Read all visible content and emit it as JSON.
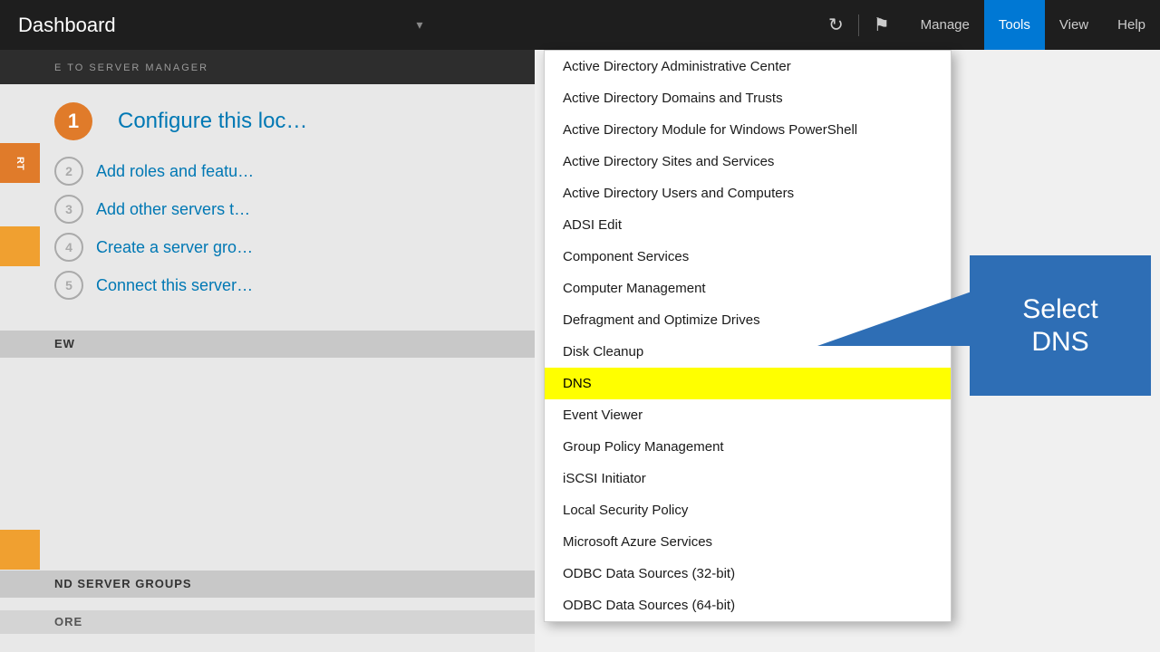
{
  "titleBar": {
    "title": "Dashboard",
    "dropdownArrow": "▾",
    "refreshIcon": "↻",
    "flagIcon": "⚑"
  },
  "menuBar": {
    "items": [
      {
        "label": "Manage",
        "active": false
      },
      {
        "label": "Tools",
        "active": true
      },
      {
        "label": "View",
        "active": false
      },
      {
        "label": "Help",
        "active": false
      }
    ]
  },
  "leftPanel": {
    "welcomeSubtitle": "WELCOME TO SERVER MANAGER",
    "quickStartHeader": "Configure this loc…",
    "step1": {
      "number": "1",
      "label": "Configure this loc…"
    },
    "step2": {
      "number": "2",
      "label": "Add roles and featu…"
    },
    "step3": {
      "number": "3",
      "label": "Add other servers t…"
    },
    "step4": {
      "number": "4",
      "label": "Create a server gro…"
    },
    "step5": {
      "number": "5",
      "label": "Connect this server…"
    },
    "sectionStart": "RT",
    "sectionEW": "EW",
    "sectionBottomLabel": "ND SERVER GROUPS",
    "sectionBottomMore": "ORE"
  },
  "dropdown": {
    "items": [
      {
        "label": "Active Directory Administrative Center",
        "highlighted": false
      },
      {
        "label": "Active Directory Domains and Trusts",
        "highlighted": false
      },
      {
        "label": "Active Directory Module for Windows PowerShell",
        "highlighted": false
      },
      {
        "label": "Active Directory Sites and Services",
        "highlighted": false
      },
      {
        "label": "Active Directory Users and Computers",
        "highlighted": false
      },
      {
        "label": "ADSI Edit",
        "highlighted": false
      },
      {
        "label": "Component Services",
        "highlighted": false
      },
      {
        "label": "Computer Management",
        "highlighted": false
      },
      {
        "label": "Defragment and Optimize Drives",
        "highlighted": false
      },
      {
        "label": "Disk Cleanup",
        "highlighted": false
      },
      {
        "label": "DNS",
        "highlighted": true
      },
      {
        "label": "Event Viewer",
        "highlighted": false
      },
      {
        "label": "Group Policy Management",
        "highlighted": false
      },
      {
        "label": "iSCSI Initiator",
        "highlighted": false
      },
      {
        "label": "Local Security Policy",
        "highlighted": false
      },
      {
        "label": "Microsoft Azure Services",
        "highlighted": false
      },
      {
        "label": "ODBC Data Sources (32-bit)",
        "highlighted": false
      },
      {
        "label": "ODBC Data Sources (64-bit)",
        "highlighted": false
      }
    ]
  },
  "callout": {
    "line1": "Select",
    "line2": "DNS"
  }
}
